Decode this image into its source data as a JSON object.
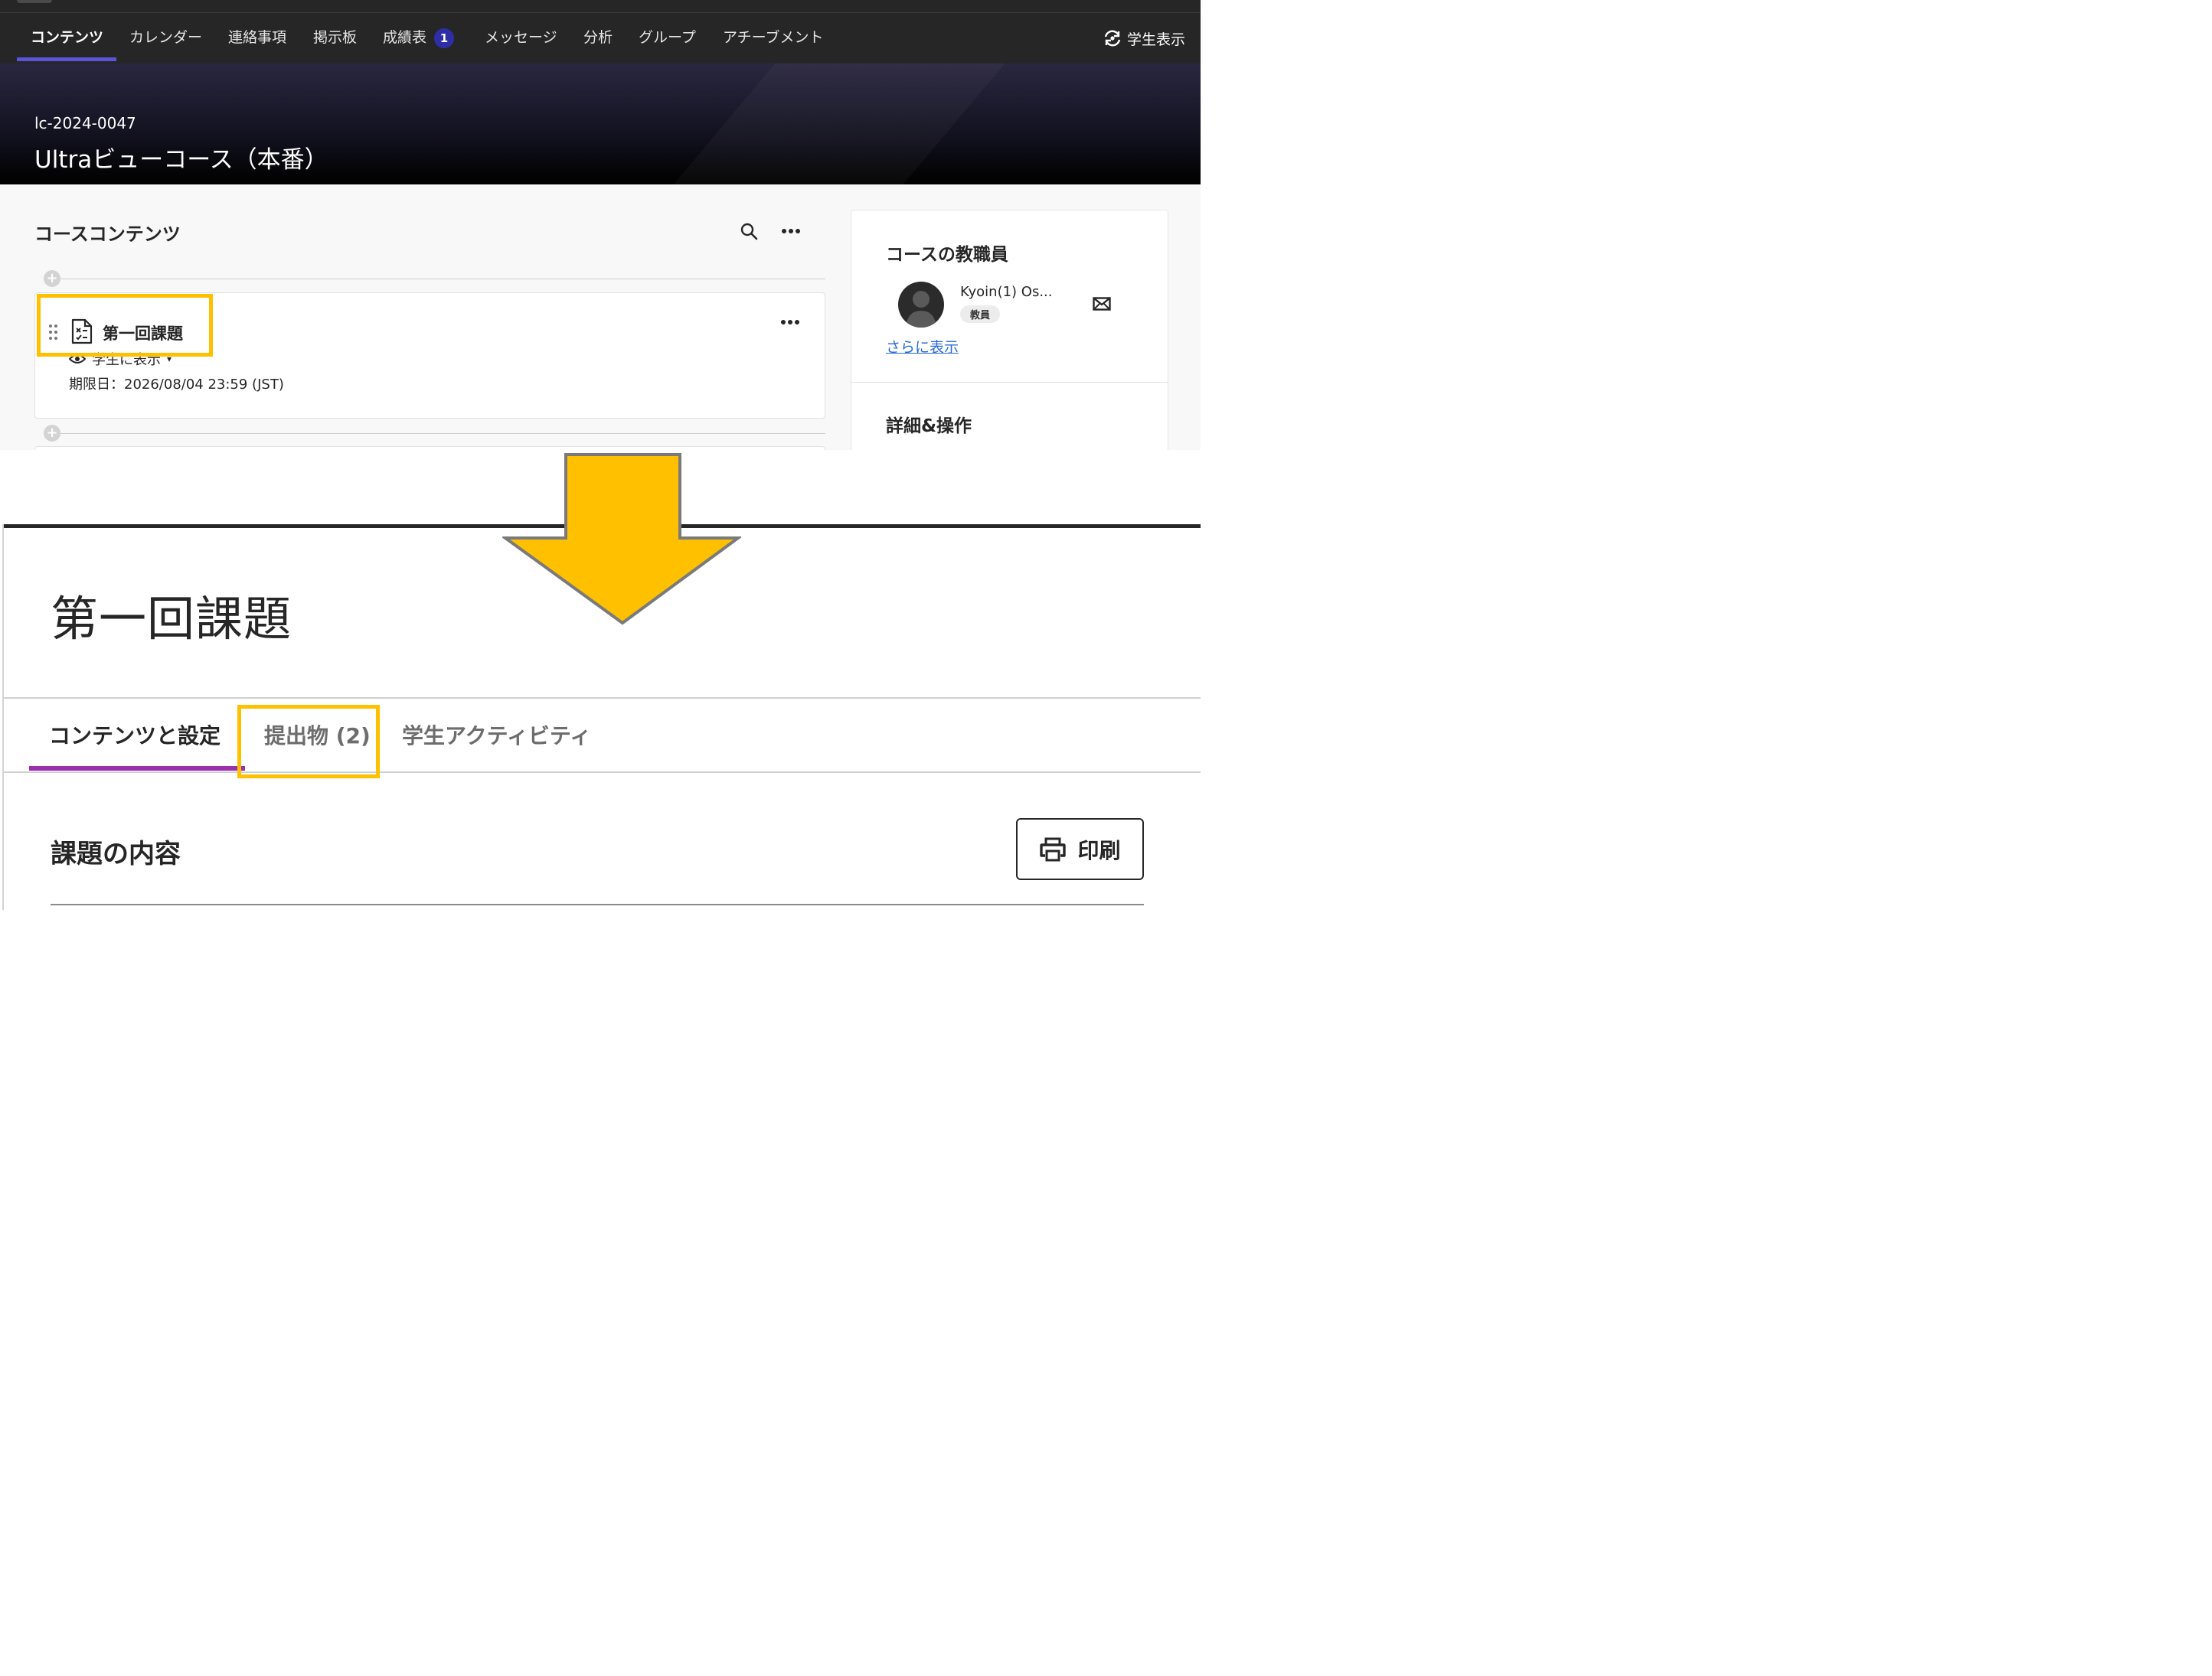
{
  "colors": {
    "highlight": "#ffc000",
    "nav_background": "#262626",
    "nav_active_underline": "#5a54d8",
    "badge": "#2e2fa8",
    "tab_active_underline": "#9b2fae",
    "link": "#2a6bd8"
  },
  "course_view": {
    "nav": {
      "items": [
        {
          "label": "コンテンツ",
          "active": true
        },
        {
          "label": "カレンダー"
        },
        {
          "label": "連絡事項"
        },
        {
          "label": "掲示板"
        },
        {
          "label": "成績表",
          "badge": "1"
        },
        {
          "label": "メッセージ"
        },
        {
          "label": "分析"
        },
        {
          "label": "グループ"
        },
        {
          "label": "アチーブメント"
        }
      ],
      "student_view_label": "学生表示",
      "student_view_icon": "refresh-eye-icon"
    },
    "banner": {
      "course_id": "lc-2024-0047",
      "course_title": "Ultraビューコース（本番）"
    },
    "content": {
      "title": "コースコンテンツ",
      "search_icon": "search-icon",
      "more_icon": "more-horizontal-icon",
      "item": {
        "icon": "assignment-document-icon",
        "name": "第一回課題",
        "visibility_label": "学生に表示",
        "visibility_icon": "eye-icon",
        "due": "期限日：2026/08/04 23:59 (JST)"
      }
    },
    "sidebar": {
      "staff_title": "コースの教職員",
      "staff_name": "Kyoin(1) Os...",
      "staff_role": "教員",
      "mail_icon": "mail-icon",
      "more_link": "さらに表示",
      "details_title": "詳細&操作"
    }
  },
  "assignment_view": {
    "title": "第一回課題",
    "tabs": [
      {
        "label": "コンテンツと設定",
        "active": true
      },
      {
        "label": "提出物 (2)",
        "highlighted": true
      },
      {
        "label": "学生アクティビティ"
      }
    ],
    "section_title": "課題の内容",
    "print_button": "印刷",
    "print_icon": "printer-icon"
  },
  "annotation": {
    "arrow_icon": "down-arrow-icon",
    "arrow_color": "#ffc000"
  }
}
